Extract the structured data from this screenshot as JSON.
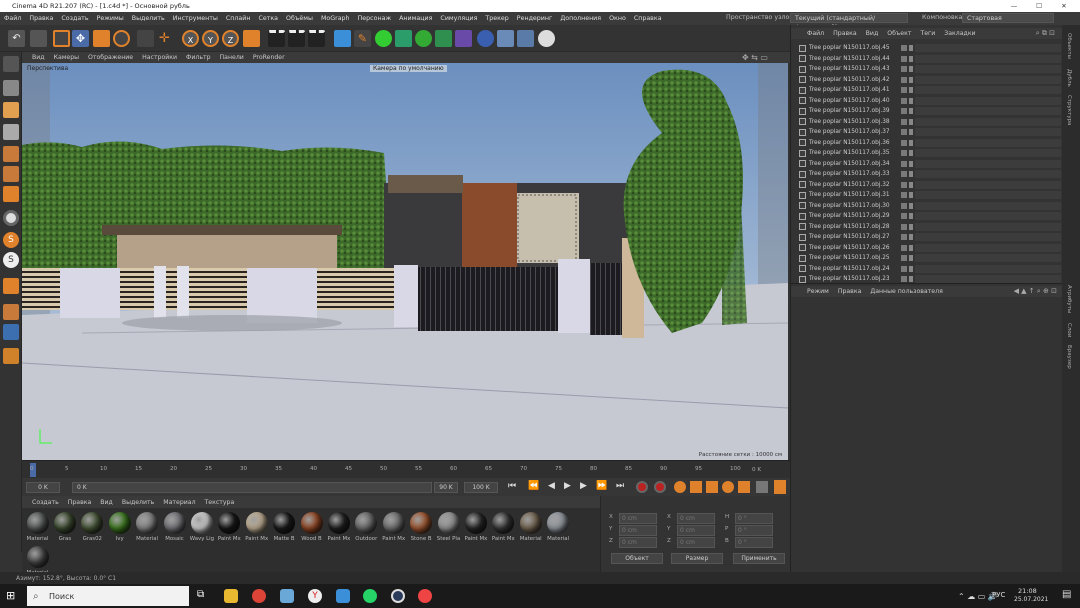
{
  "window": {
    "title": "Cinema 4D R21.207 (RC) - [1.c4d *] - Основной рубль",
    "min": "—",
    "max": "☐",
    "close": "✕"
  },
  "menu": {
    "items": [
      "Файл",
      "Правка",
      "Создать",
      "Режимы",
      "Выделить",
      "Инструменты",
      "Сплайн",
      "Сетка",
      "Объёмы",
      "MoGraph",
      "Персонаж",
      "Анимация",
      "Симуляция",
      "Трекер",
      "Рендеринг",
      "Дополнения",
      "Окно",
      "Справка"
    ],
    "node_space_label": "Пространство узлов",
    "node_space_value": "Текущий (стандартный/физический)",
    "layout_label": "Компоновка",
    "layout_value": "Стартовая"
  },
  "viewport": {
    "menu": [
      "Вид",
      "Камеры",
      "Отображение",
      "Настройки",
      "Фильтр",
      "Панели",
      "ProRender"
    ],
    "label": "Перспектива",
    "camera": "Камера по умолчанию",
    "grid_info": "Расстояние сетки : 10000 см"
  },
  "timeline": {
    "ticks": [
      "0",
      "5",
      "10",
      "15",
      "20",
      "25",
      "30",
      "35",
      "40",
      "45",
      "50",
      "55",
      "60",
      "65",
      "70",
      "75",
      "80",
      "85",
      "90",
      "95",
      "100"
    ],
    "end_label": "0 K"
  },
  "transport": {
    "current": "0 K",
    "start": "0 K",
    "end_time": "90 K",
    "max": "100 K"
  },
  "materials": {
    "menu": [
      "Создать",
      "Правка",
      "Вид",
      "Выделить",
      "Материал",
      "Текстура"
    ],
    "items": [
      {
        "name": "Material",
        "color": "#5a5f5c"
      },
      {
        "name": "Gras",
        "color": "#3f4f32"
      },
      {
        "name": "Gras02",
        "color": "#4a5a3a"
      },
      {
        "name": "Ivy",
        "color": "#3f7f1f"
      },
      {
        "name": "Material",
        "color": "#8a8a8a"
      },
      {
        "name": "Mosaic",
        "color": "#7a7a80"
      },
      {
        "name": "Wavy Lig",
        "color": "#dcdcdc"
      },
      {
        "name": "Paint Mx",
        "color": "#1a1a1a"
      },
      {
        "name": "Paint Mx",
        "color": "#c9b79a"
      },
      {
        "name": "Matte B",
        "color": "#1c1c1c"
      },
      {
        "name": "Wood B",
        "color": "#9a4a25"
      },
      {
        "name": "Paint Mx",
        "color": "#222222"
      },
      {
        "name": "Outdoor",
        "color": "#707070"
      },
      {
        "name": "Paint Mx",
        "color": "#777777"
      },
      {
        "name": "Stone B",
        "color": "#a85a32"
      },
      {
        "name": "Steel Pla",
        "color": "#9a9a9a"
      },
      {
        "name": "Paint Mx",
        "color": "#2a2a2a"
      },
      {
        "name": "Paint Mx",
        "color": "#3a3a3a"
      },
      {
        "name": "Material",
        "color": "#7a6a55"
      },
      {
        "name": "Material",
        "color": "#9aa0a8"
      },
      {
        "name": "Material",
        "color": "#4a4a4a"
      }
    ]
  },
  "coords": {
    "rows": [
      [
        "X",
        "0 cm",
        "X",
        "0 cm",
        "H",
        "0 °"
      ],
      [
        "Y",
        "0 cm",
        "Y",
        "0 cm",
        "P",
        "0 °"
      ],
      [
        "Z",
        "0 cm",
        "Z",
        "0 cm",
        "B",
        "0 °"
      ]
    ],
    "mode": "Объект",
    "size_mode": "Размер",
    "apply": "Применить"
  },
  "objects": {
    "menu": [
      "Файл",
      "Правка",
      "Вид",
      "Объект",
      "Теги",
      "Закладки"
    ],
    "rows": [
      "Tree poplar N150117.obj.45",
      "Tree poplar N150117.obj.44",
      "Tree poplar N150117.obj.43",
      "Tree poplar N150117.obj.42",
      "Tree poplar N150117.obj.41",
      "Tree poplar N150117.obj.40",
      "Tree poplar N150117.obj.39",
      "Tree poplar N150117.obj.38",
      "Tree poplar N150117.obj.37",
      "Tree poplar N150117.obj.36",
      "Tree poplar N150117.obj.35",
      "Tree poplar N150117.obj.34",
      "Tree poplar N150117.obj.33",
      "Tree poplar N150117.obj.32",
      "Tree poplar N150117.obj.31",
      "Tree poplar N150117.obj.30",
      "Tree poplar N150117.obj.29",
      "Tree poplar N150117.obj.28",
      "Tree poplar N150117.obj.27",
      "Tree poplar N150117.obj.26",
      "Tree poplar N150117.obj.25",
      "Tree poplar N150117.obj.24",
      "Tree poplar N150117.obj.23"
    ]
  },
  "attributes": {
    "menu": [
      "Режим",
      "Правка",
      "Данные пользователя"
    ]
  },
  "sidetabs": [
    "Объекты",
    "Дубль",
    "Структура",
    "Атрибуты",
    "Слои",
    "Браузер"
  ],
  "status": "Азимут: 152.8°, Высота: 0.0°  С1",
  "taskbar": {
    "search": "Поиск",
    "lang": "РУС",
    "time": "21:08",
    "date": "25.07.2021"
  }
}
